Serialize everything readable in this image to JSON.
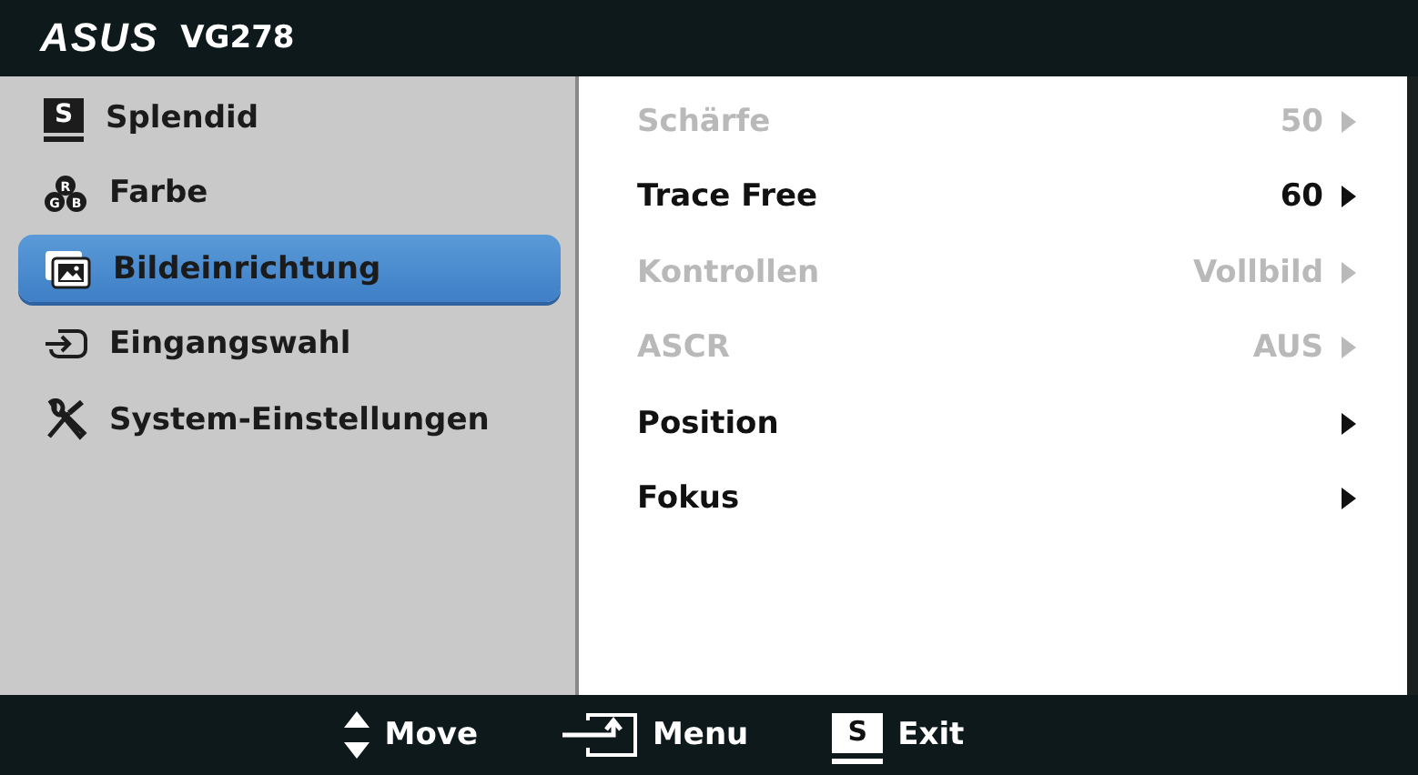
{
  "header": {
    "logo": "ASUS",
    "model": "VG278"
  },
  "sidebar": {
    "items": [
      {
        "label": "Splendid",
        "kind": "splendid",
        "icon_text": "S",
        "selected": false
      },
      {
        "label": "Farbe",
        "kind": "color",
        "icon_letters": [
          "R",
          "G",
          "B"
        ],
        "selected": false
      },
      {
        "label": "Bildeinrichtung",
        "kind": "image",
        "selected": true
      },
      {
        "label": "Eingangswahl",
        "kind": "input",
        "selected": false
      },
      {
        "label": "System-Einstellungen",
        "kind": "tools",
        "selected": false
      }
    ]
  },
  "settings": [
    {
      "label": "Schärfe",
      "value": "50",
      "disabled": true
    },
    {
      "label": "Trace Free",
      "value": "60",
      "disabled": false
    },
    {
      "label": "Kontrollen",
      "value": "Vollbild",
      "disabled": true
    },
    {
      "label": "ASCR",
      "value": "AUS",
      "disabled": true
    },
    {
      "label": "Position",
      "disabled": false
    },
    {
      "label": "Fokus",
      "disabled": false
    }
  ],
  "footer": [
    {
      "kind": "move",
      "label": "Move"
    },
    {
      "kind": "menu",
      "label": "Menu"
    },
    {
      "kind": "exit",
      "label": "Exit",
      "icon_text": "S"
    }
  ]
}
